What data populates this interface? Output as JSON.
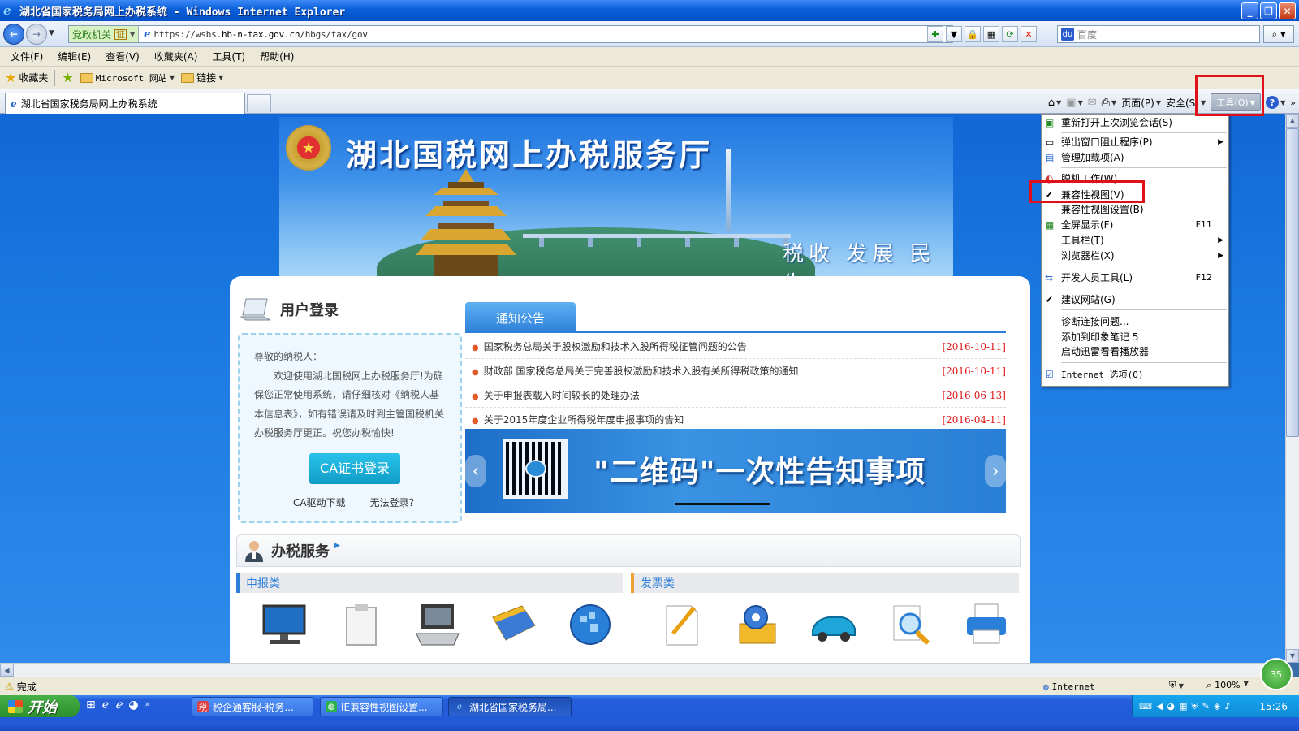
{
  "window": {
    "title": "湖北省国家税务局网上办税系统 - Windows Internet Explorer"
  },
  "address": {
    "zone_label": "党政机关",
    "url_prefix": "https://wsbs.",
    "url_host": "hb-n-tax.gov.cn",
    "url_path": "/hbgs/tax/gov",
    "search_placeholder": "百度"
  },
  "menubar": {
    "items": [
      "文件(F)",
      "编辑(E)",
      "查看(V)",
      "收藏夹(A)",
      "工具(T)",
      "帮助(H)"
    ]
  },
  "favbar": {
    "favorites": "收藏夹",
    "microsoft": "Microsoft 网站",
    "links": "链接"
  },
  "tabbar": {
    "tab_title": "湖北省国家税务局网上办税系统",
    "page": "页面(P)",
    "safety": "安全(S)",
    "tools": "工具(O)"
  },
  "banner": {
    "title": "湖北国税网上办税服务厅",
    "slogan": "税收 发展 民生"
  },
  "login": {
    "heading": "用户登录",
    "greeting": "尊敬的纳税人：",
    "body": "欢迎使用湖北国税网上办税服务厅!为确保您正常使用系统，请仔细核对《纳税人基本信息表》，如有错误请及时到主管国税机关办税服务厅更正。祝您办税愉快!",
    "ca_button": "CA证书登录",
    "ca_driver": "CA驱动下载",
    "cannot_login": "无法登录？"
  },
  "notices": {
    "tab": "通知公告",
    "items": [
      {
        "title": "国家税务总局关于股权激励和技术入股所得税征管问题的公告",
        "date": "[2016-10-11]"
      },
      {
        "title": "财政部 国家税务总局关于完善股权激励和技术入股有关所得税政策的通知",
        "date": "[2016-10-11]"
      },
      {
        "title": "关于申报表载入时间较长的处理办法",
        "date": "[2016-06-13]"
      },
      {
        "title": "关于2015年度企业所得税年度申报事项的告知",
        "date": "[2016-04-11]"
      }
    ],
    "carousel_text": "\"二维码\"一次性告知事项"
  },
  "services": {
    "heading": "办税服务",
    "report_category": "申报类",
    "invoice_category": "发票类"
  },
  "tools_menu": {
    "items": [
      {
        "label": "重新打开上次浏览会话(S)",
        "key": ""
      },
      {
        "label": "弹出窗口阻止程序(P)",
        "key": ""
      },
      {
        "label": "管理加载项(A)",
        "key": ""
      },
      {
        "label": "脱机工作(W)",
        "key": ""
      },
      {
        "label": "兼容性视图(V)",
        "key": ""
      },
      {
        "label": "兼容性视图设置(B)",
        "key": ""
      },
      {
        "label": "全屏显示(F)",
        "key": "F11"
      },
      {
        "label": "工具栏(T)",
        "key": ""
      },
      {
        "label": "浏览器栏(X)",
        "key": ""
      },
      {
        "label": "开发人员工具(L)",
        "key": "F12"
      },
      {
        "label": "建议网站(G)",
        "key": ""
      },
      {
        "label": "诊断连接问题...",
        "key": ""
      },
      {
        "label": "添加到印象笔记 5",
        "key": ""
      },
      {
        "label": "启动迅雷看看播放器",
        "key": ""
      },
      {
        "label": "Internet 选项(O)",
        "key": ""
      }
    ]
  },
  "status": {
    "text": "完成",
    "zone": "Internet",
    "zoom": "100%"
  },
  "taskbar": {
    "start": "开始",
    "tasks": [
      "税企通客服-税务...",
      "IE兼容性视图设置...",
      "湖北省国家税务局..."
    ],
    "clock": "15:26",
    "badge": "35"
  }
}
